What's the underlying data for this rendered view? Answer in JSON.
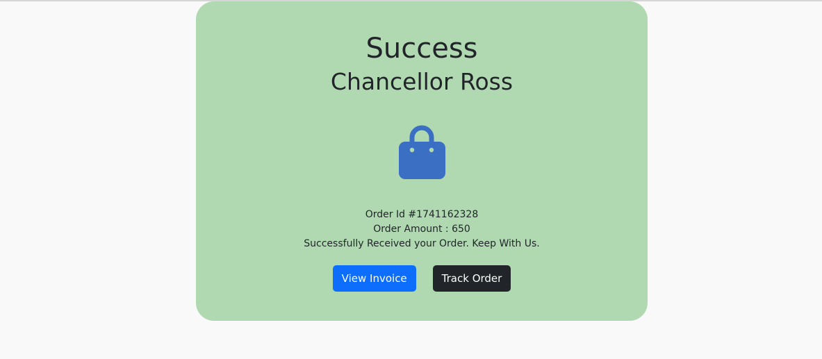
{
  "card": {
    "title": "Success",
    "customer_name": "Chancellor Ross",
    "icon": "shopping-bag-icon",
    "order_id": "Order Id #1741162328",
    "order_amount": "Order Amount : 650",
    "message": "Successfully Received your Order. Keep With Us."
  },
  "actions": {
    "view_invoice_label": "View Invoice",
    "track_order_label": "Track Order"
  },
  "colors": {
    "card_background": "#b0d9b1",
    "icon": "#3a6fc4",
    "primary_button": "#0d6efd",
    "dark_button": "#212529"
  }
}
